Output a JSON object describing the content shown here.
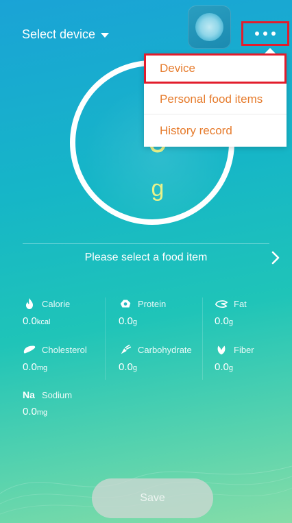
{
  "header": {
    "select_device_label": "Select device"
  },
  "dial": {
    "weight_value": "0",
    "weight_unit": "g"
  },
  "more_menu": {
    "items": [
      {
        "label": "Device"
      },
      {
        "label": "Personal food items"
      },
      {
        "label": "History record"
      }
    ]
  },
  "food_selector": {
    "label": "Please select a food item"
  },
  "nutrients": {
    "calorie": {
      "label": "Calorie",
      "value": "0.0",
      "unit": "kcal",
      "icon": "flame-icon"
    },
    "protein": {
      "label": "Protein",
      "value": "0.0",
      "unit": "g",
      "icon": "protein-icon"
    },
    "fat": {
      "label": "Fat",
      "value": "0.0",
      "unit": "g",
      "icon": "fat-icon"
    },
    "cholesterol": {
      "label": "Cholesterol",
      "value": "0.0",
      "unit": "mg",
      "icon": "liver-icon"
    },
    "carbohydrate": {
      "label": "Carbohydrate",
      "value": "0.0",
      "unit": "g",
      "icon": "carbohydrate-icon"
    },
    "fiber": {
      "label": "Fiber",
      "value": "0.0",
      "unit": "g",
      "icon": "leaf-icon"
    },
    "sodium": {
      "label": "Sodium",
      "symbol": "Na",
      "value": "0.0",
      "unit": "mg"
    }
  },
  "actions": {
    "save_label": "Save"
  },
  "colors": {
    "menu_text": "#e67b2c",
    "highlight_border": "#e21d2c",
    "dial_digits": "#e8f28a"
  }
}
